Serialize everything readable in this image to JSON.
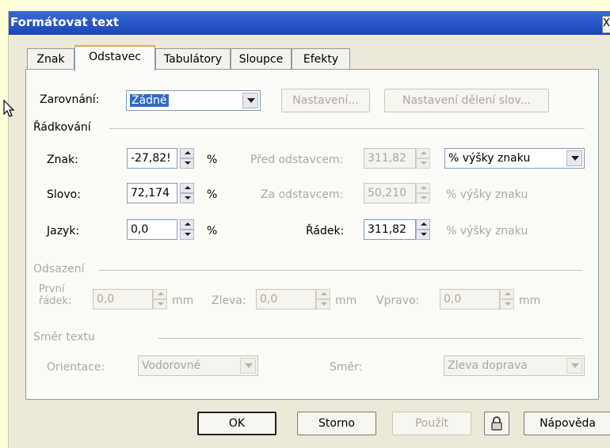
{
  "window": {
    "title": "Formátovat text",
    "close_glyph": "X"
  },
  "tabs": [
    "Znak",
    "Odstavec",
    "Tabulátory",
    "Sloupce",
    "Efekty"
  ],
  "active_tab": "Odstavec",
  "alignment": {
    "label": "Zarovnání:",
    "value": "Žádné",
    "settings_button": "Nastavení...",
    "hyphenation_button": "Nastavení dělení slov..."
  },
  "spacing": {
    "group_label": "Řádkování",
    "char_label": "Znak:",
    "char_value": "-27,82!",
    "char_unit": "%",
    "word_label": "Slovo:",
    "word_value": "72,174",
    "word_unit": "%",
    "lang_label": "Jazyk:",
    "lang_value": "0,0",
    "lang_unit": "%",
    "before_label": "Před odstavcem:",
    "before_value": "311,82",
    "before_unit": "% výšky znaku",
    "after_label": "Za odstavcem:",
    "after_value": "50,210",
    "after_unit": "% výšky znaku",
    "line_label": "Řádek:",
    "line_value": "311,82",
    "line_unit": "% výšky znaku"
  },
  "indent": {
    "group_label": "Odsazení",
    "first_label_1": "První",
    "first_label_2": "řádek:",
    "first_value": "0,0",
    "left_label": "Zleva:",
    "left_value": "0,0",
    "right_label": "Vpravo:",
    "right_value": "0,0",
    "unit": "mm"
  },
  "direction": {
    "group_label": "Směr textu",
    "orientation_label": "Orientace:",
    "orientation_value": "Vodorovné",
    "direction_label": "Směr:",
    "direction_value": "Zleva doprava"
  },
  "buttons": {
    "ok": "OK",
    "cancel": "Storno",
    "apply": "Použít",
    "help": "Nápověda"
  },
  "colors": {
    "dialog_bg": "#ece9d8",
    "title_bar": "#2453c7",
    "selection": "#316ac5",
    "page_bg": "#ffffd8"
  },
  "icons": [
    "lock-icon",
    "chevron-down-icon",
    "spin-up-icon",
    "spin-down-icon"
  ]
}
